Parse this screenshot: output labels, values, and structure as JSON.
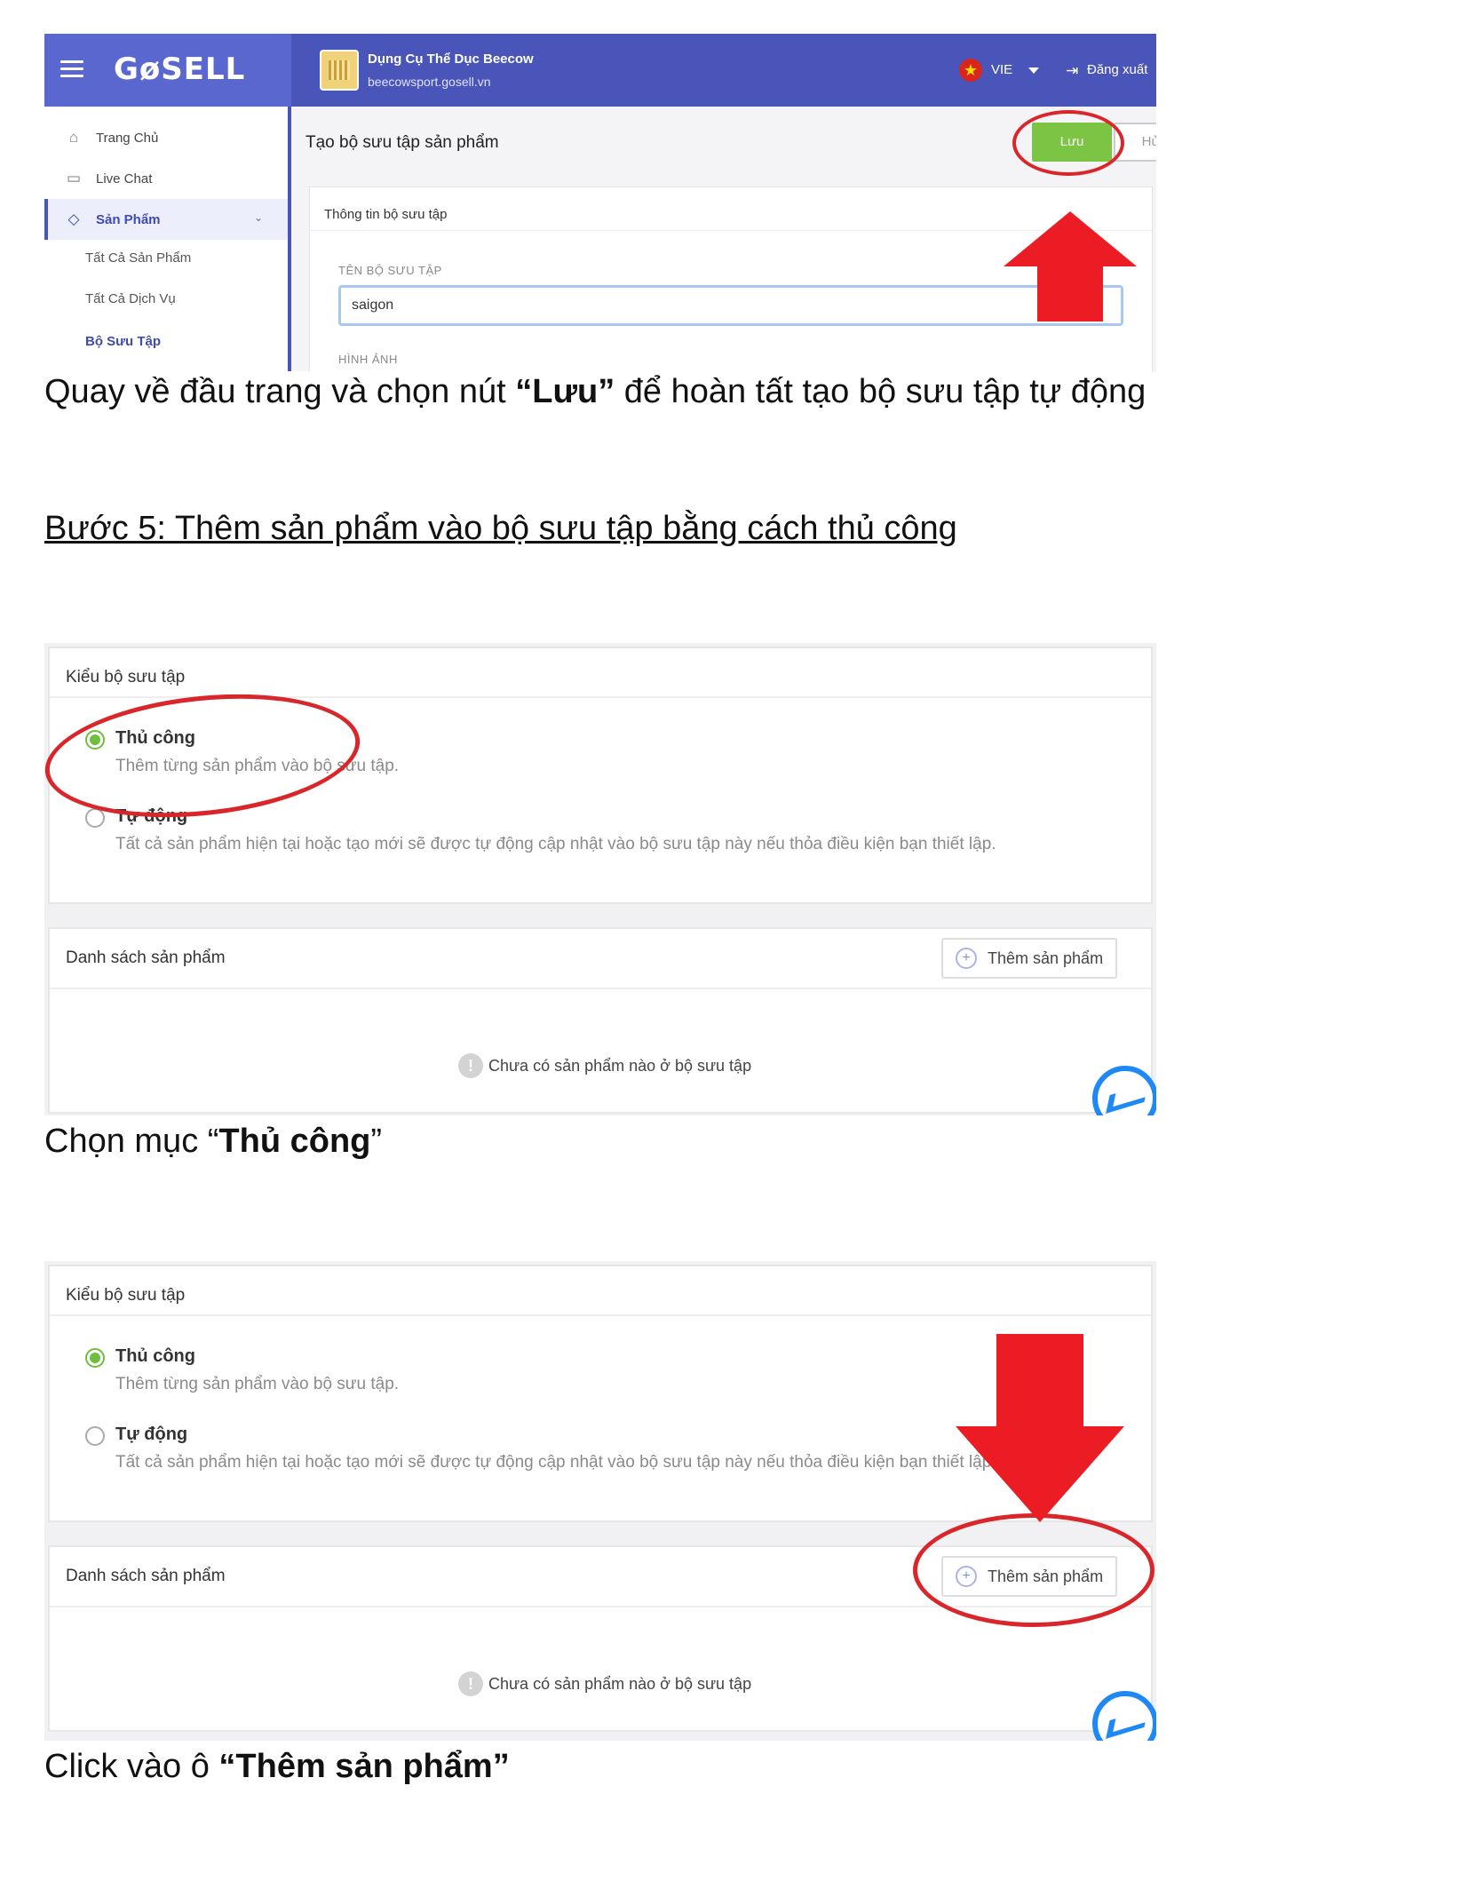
{
  "shot1": {
    "logo": "GøSELL",
    "store_name": "Dụng Cụ Thể Dục Beecow",
    "store_url": "beecowsport.gosell.vn",
    "lang": "VIE",
    "logout": "Đăng xuất",
    "sidebar": {
      "home": "Trang Chủ",
      "livechat": "Live Chat",
      "products": "Sản Phẩm",
      "all_products": "Tất Cả Sản Phẩm",
      "all_services": "Tất Cả Dịch Vụ",
      "collections": "Bộ Sưu Tập"
    },
    "page_title": "Tạo bộ sưu tập sản phẩm",
    "save_label": "Lưu",
    "cancel_label": "Hủy",
    "card_title": "Thông tin bộ sưu tập",
    "name_label": "TÊN BỘ SƯU TẬP",
    "name_value": "saigon",
    "image_label": "HÌNH ẢNH"
  },
  "caption1": {
    "before": "Quay về đầu trang và chọn nút ",
    "bold": "“Lưu”",
    "after": " để hoàn tất tạo bộ sưu tập tự động"
  },
  "step5_heading": "Bước 5: Thêm sản phẩm vào bộ sưu tập bằng cách thủ công",
  "collection_ui": {
    "type_title": "Kiểu bộ sưu tập",
    "manual_title": "Thủ công",
    "manual_desc": "Thêm từng sản phẩm vào bộ sưu tập.",
    "auto_title": "Tự động",
    "auto_desc": "Tất cả sản phẩm hiện tại hoặc tạo mới sẽ được tự động cập nhật vào bộ sưu tập này nếu thỏa điều kiện bạn thiết lập.",
    "list_title": "Danh sách sản phẩm",
    "add_product": "Thêm sản phẩm",
    "empty": "Chưa có sản phẩm nào ở bộ sưu tập"
  },
  "caption2": {
    "before": "Chọn mục “",
    "bold": "Thủ công",
    "after": "”"
  },
  "caption3": {
    "before": "Click vào ô  ",
    "bold": "“Thêm sản phẩm”"
  },
  "colors": {
    "header": "#4a55b9",
    "save_green": "#7cc443",
    "annotation_red": "#d9262a",
    "radio_green": "#6fbe3f"
  }
}
